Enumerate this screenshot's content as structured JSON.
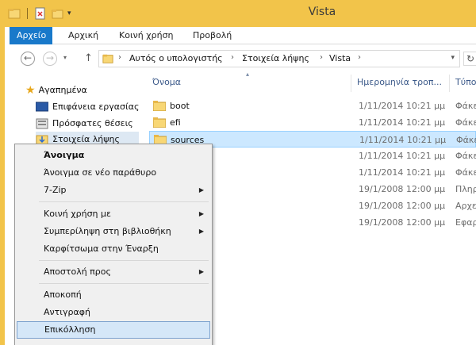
{
  "window": {
    "title": "Vista"
  },
  "ribbon": {
    "tabs": [
      {
        "label": "Αρχείο",
        "active": true
      },
      {
        "label": "Αρχική"
      },
      {
        "label": "Κοινή χρήση"
      },
      {
        "label": "Προβολή"
      }
    ]
  },
  "address": {
    "segments": [
      "Αυτός ο υπολογιστής",
      "Στοιχεία λήψης",
      "Vista"
    ]
  },
  "nav": {
    "favorites": "Αγαπημένα",
    "items": [
      "Επιφάνεια εργασίας",
      "Πρόσφατες θέσεις",
      "Στοιχεία λήψης"
    ]
  },
  "list": {
    "columns": {
      "name": "Όνομα",
      "date": "Ημερομηνία τροπ...",
      "type": "Τύπος"
    },
    "rows": [
      {
        "name": "boot",
        "date": "1/11/2014 10:21 μμ",
        "type": "Φάκελ"
      },
      {
        "name": "efi",
        "date": "1/11/2014 10:21 μμ",
        "type": "Φάκελ"
      },
      {
        "name": "sources",
        "date": "1/11/2014 10:21 μμ",
        "type": "Φάκελ"
      },
      {
        "name": "",
        "date": "1/11/2014 10:21 μμ",
        "type": "Φάκελ"
      },
      {
        "name": "",
        "date": "1/11/2014 10:21 μμ",
        "type": "Φάκελ"
      },
      {
        "name": "",
        "date": "19/1/2008 12:00 μμ",
        "type": "Πληρο"
      },
      {
        "name": "",
        "date": "19/1/2008 12:00 μμ",
        "type": "Αρχεί"
      },
      {
        "name": "",
        "date": "19/1/2008 12:00 μμ",
        "type": "Εφαρμ"
      }
    ]
  },
  "context_menu": {
    "items": [
      {
        "label": "Άνοιγμα"
      },
      {
        "label": "Άνοιγμα σε νέο παράθυρο"
      },
      {
        "label": "7-Zip"
      },
      {
        "label": "Κοινή χρήση με"
      },
      {
        "label": "Συμπερίληψη στη βιβλιοθήκη"
      },
      {
        "label": "Καρφίτσωμα στην Έναρξη"
      },
      {
        "label": "Αποστολή προς"
      },
      {
        "label": "Αποκοπή"
      },
      {
        "label": "Αντιγραφή"
      },
      {
        "label": "Επικόλληση"
      }
    ]
  },
  "colors": {
    "accent": "#1979ca",
    "frame": "#f2c44a",
    "selection": "#cce8ff",
    "highlight": "#d5e7f8"
  }
}
